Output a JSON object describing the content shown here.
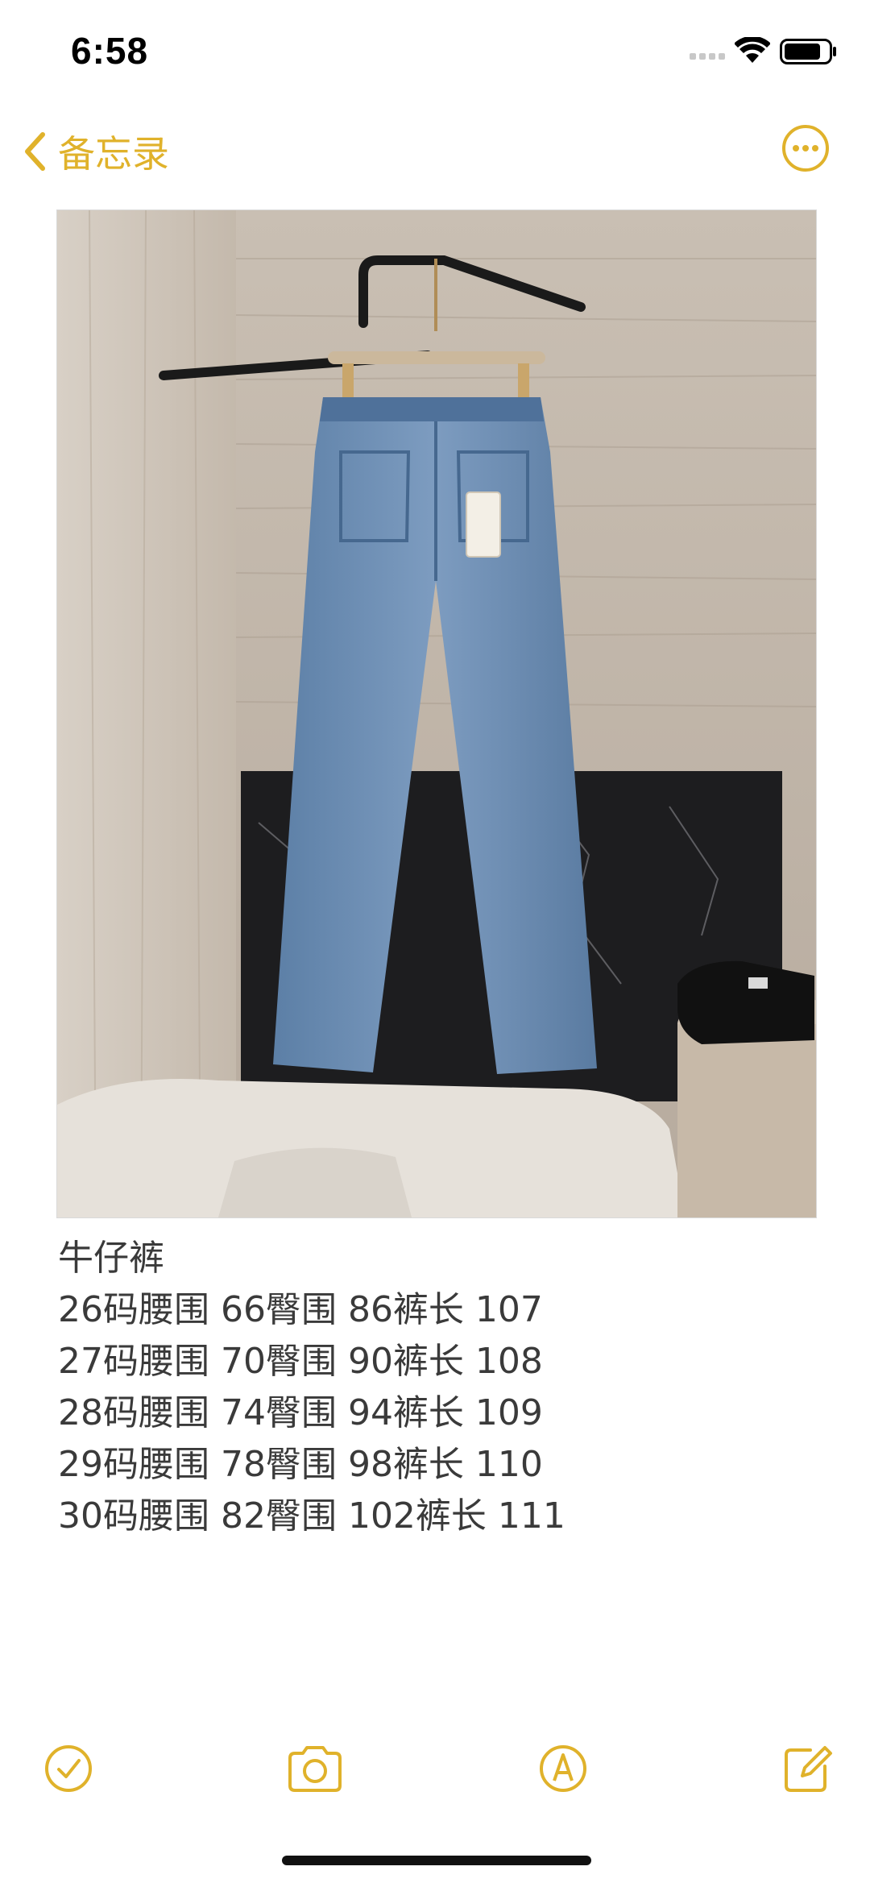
{
  "status_bar": {
    "time": "6:58"
  },
  "nav": {
    "back_label": "备忘录",
    "accent_color": "#E0B22B"
  },
  "note": {
    "image_alt": "photo",
    "lines": [
      "牛仔裤",
      "26码腰围 66臀围 86裤长 107",
      "27码腰围 70臀围 90裤长 108",
      "28码腰围 74臀围 94裤长 109",
      "29码腰围 78臀围 98裤长 110",
      "30码腰围 82臀围 102裤长 111"
    ]
  },
  "toolbar": {
    "icons": [
      "checklist-icon",
      "camera-icon",
      "markup-icon",
      "compose-icon"
    ]
  }
}
